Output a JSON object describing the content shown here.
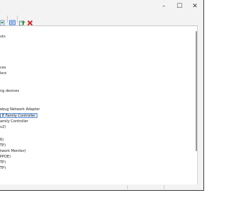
{
  "window": {
    "controls": {
      "minimize": "–",
      "maximize": "☐",
      "close": "✕"
    }
  },
  "toolbar": {
    "icons": [
      "properties-icon",
      "update-driver-icon",
      "disable-device-icon",
      "uninstall-device-icon"
    ],
    "colors": {
      "green": "#2e9b3f",
      "red": "#d42a2a",
      "blue": "#2a6fd4"
    }
  },
  "tree": {
    "rows": [
      {
        "label": "uts"
      },
      {
        "label": "ces"
      },
      {
        "label": "lers"
      },
      {
        "label": "ng devices"
      },
      {
        "label": "ebug Network Adapter"
      },
      {
        "label": "E Family Controller",
        "selected": true
      },
      {
        "label": "amily Controller"
      },
      {
        "label": "v2)"
      },
      {
        "label": "6)"
      },
      {
        "label": "TP)"
      },
      {
        "label": "twork Monitor)"
      },
      {
        "label": "PPOE)"
      },
      {
        "label": "TP)"
      },
      {
        "label": "TP)"
      }
    ]
  }
}
